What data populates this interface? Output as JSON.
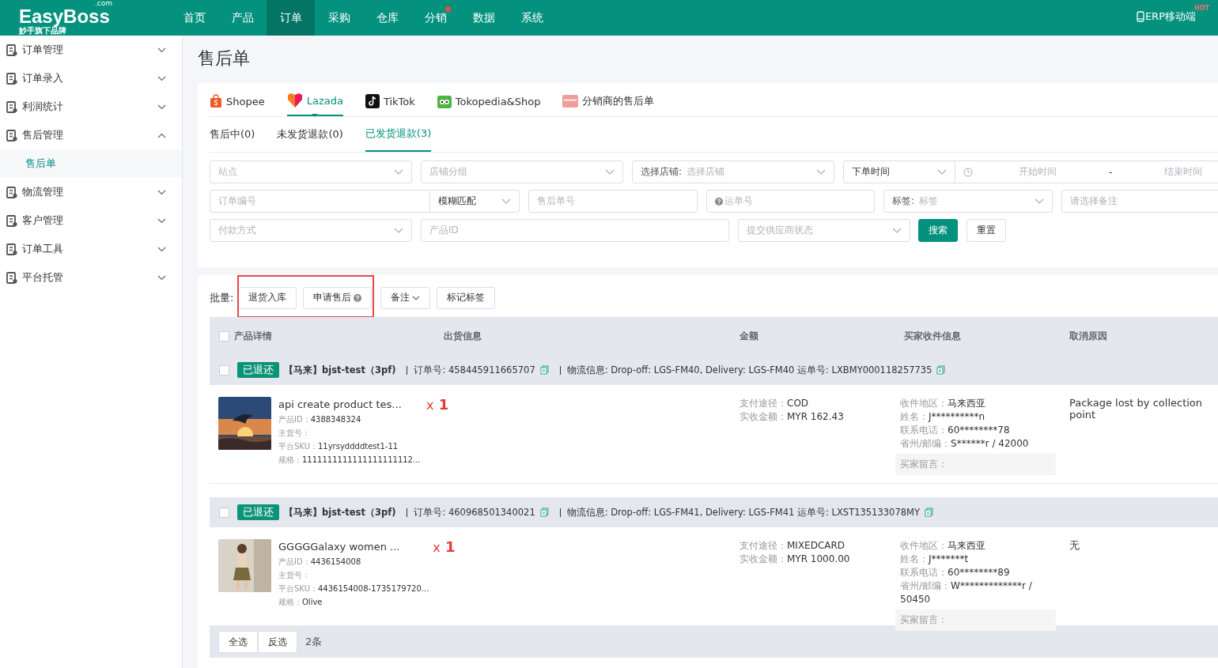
{
  "header": {
    "logo": {
      "name": "EasyBoss",
      "domain": ".com",
      "slogan": "妙手旗下品牌"
    },
    "nav": [
      {
        "label": "首页",
        "selected": false,
        "dot": false
      },
      {
        "label": "产品",
        "selected": false,
        "dot": false
      },
      {
        "label": "订单",
        "selected": true,
        "dot": false
      },
      {
        "label": "采购",
        "selected": false,
        "dot": false
      },
      {
        "label": "仓库",
        "selected": false,
        "dot": false
      },
      {
        "label": "分销",
        "selected": false,
        "dot": true
      },
      {
        "label": "数据",
        "selected": false,
        "dot": false
      },
      {
        "label": "系统",
        "selected": false,
        "dot": false
      }
    ],
    "mobile": {
      "label": "ERP移动端",
      "badge": "HOT"
    }
  },
  "sidebar": {
    "items": [
      {
        "label": "订单管理",
        "expanded": false
      },
      {
        "label": "订单录入",
        "expanded": false
      },
      {
        "label": "利润统计",
        "expanded": false
      },
      {
        "label": "售后管理",
        "expanded": true,
        "children": [
          {
            "label": "售后单",
            "selected": true
          }
        ]
      },
      {
        "label": "物流管理",
        "expanded": false
      },
      {
        "label": "客户管理",
        "expanded": false
      },
      {
        "label": "订单工具",
        "expanded": false
      },
      {
        "label": "平台托管",
        "expanded": false
      }
    ]
  },
  "page_title": "售后单",
  "platform_tabs": [
    {
      "label": "Shopee",
      "selected": false
    },
    {
      "label": "Lazada",
      "selected": true
    },
    {
      "label": "TikTok",
      "selected": false
    },
    {
      "label": "Tokopedia&Shop",
      "selected": false
    },
    {
      "label": "分销商的售后单",
      "selected": false
    }
  ],
  "status_tabs": [
    {
      "label": "售后中(0)",
      "selected": false
    },
    {
      "label": "未发货退款(0)",
      "selected": false
    },
    {
      "label": "已发货退款(3)",
      "selected": true
    }
  ],
  "filters": [
    [
      {
        "kind": "select",
        "placeholder": "站点"
      },
      {
        "kind": "select",
        "placeholder": "店铺分组"
      },
      {
        "kind": "labeled-select",
        "label": "选择店铺:",
        "placeholder": "选择店铺"
      },
      {
        "kind": "date-range",
        "label": "下单时间",
        "start": "开始时间",
        "separator": "-",
        "end": "结束时间"
      }
    ],
    [
      {
        "kind": "input-select",
        "placeholder": "订单编号",
        "value": "模糊匹配"
      },
      {
        "kind": "input",
        "placeholder": "售后单号"
      },
      {
        "kind": "help-input",
        "placeholder": "运单号"
      },
      {
        "kind": "labeled-select",
        "label": "标签:",
        "placeholder": "标签"
      },
      {
        "kind": "input",
        "placeholder": "请选择备注"
      }
    ],
    [
      {
        "kind": "select",
        "placeholder": "付款方式"
      },
      {
        "kind": "input",
        "placeholder": "产品ID"
      },
      {
        "kind": "select",
        "placeholder": "提交供应商状态"
      },
      {
        "kind": "primary",
        "label": "搜索"
      },
      {
        "kind": "plain",
        "label": "重置"
      }
    ]
  ],
  "batch": {
    "label": "批量:",
    "buttons": [
      {
        "label": "退货入库",
        "kind": "plain"
      },
      {
        "label": "申请售后",
        "kind": "help"
      },
      {
        "label": "备注",
        "kind": "dropdown"
      },
      {
        "label": "标记标签",
        "kind": "plain"
      }
    ]
  },
  "table": {
    "header_checked": false,
    "columns": [
      "产品详情",
      "出货信息",
      "金额",
      "买家收件信息",
      "取消原因"
    ],
    "orders": [
      {
        "checked": false,
        "status": "已退还",
        "shop": "【马来】bjst-test（3pf)",
        "order_no": "订单号: 458445911665707",
        "logistics": "物流信息: Drop-off: LGS-FM40, Delivery: LGS-FM40 运单号: LXBMY000118257735",
        "product": {
          "title": "api create product tes...",
          "qty_prefix": "x",
          "qty": "1",
          "lines": [
            {
              "label": "产品ID：",
              "value": "4388348324"
            },
            {
              "label": "主货号："
            },
            {
              "label": "平台SKU：",
              "value": "11yrsyddddtest1-11"
            },
            {
              "label": "规格：",
              "value": "1111111111111111111112..."
            }
          ]
        },
        "amount": [
          {
            "label": "支付途径：",
            "value": "COD"
          },
          {
            "label": "实收金额：",
            "value": "MYR 162.43"
          }
        ],
        "buyer": [
          {
            "label": "收件地区：",
            "value": "马来西亚"
          },
          {
            "label": "姓名：",
            "value": "J**********n"
          },
          {
            "label": "联系电话：",
            "value": "60********78"
          },
          {
            "label": "省州/邮编：",
            "value": "S******r / 42000"
          }
        ],
        "note": "买家留言：",
        "reason": "Package lost by collection point"
      },
      {
        "checked": false,
        "status": "已退还",
        "shop": "【马来】bjst-test（3pf)",
        "order_no": "订单号: 460968501340021",
        "logistics": "物流信息: Drop-off: LGS-FM41, Delivery: LGS-FM41 运单号: LXST135133078MY",
        "product": {
          "title": "GGGGGalaxy women ...",
          "qty_prefix": "x",
          "qty": "1",
          "lines": [
            {
              "label": "产品ID：",
              "value": "4436154008"
            },
            {
              "label": "主货号："
            },
            {
              "label": "平台SKU：",
              "value": "4436154008-1735179720..."
            },
            {
              "label": "规格：",
              "value": "Olive"
            }
          ]
        },
        "amount": [
          {
            "label": "支付途径：",
            "value": "MIXEDCARD"
          },
          {
            "label": "实收金额：",
            "value": "MYR 1000.00"
          }
        ],
        "buyer": [
          {
            "label": "收件地区：",
            "value": "马来西亚"
          },
          {
            "label": "姓名：",
            "value": "J*******t"
          },
          {
            "label": "联系电话：",
            "value": "60********89"
          },
          {
            "label": "省州/邮编：",
            "value": "W*************r / 50450"
          }
        ],
        "note": "买家留言：",
        "reason": "无"
      }
    ]
  },
  "footer": {
    "buttons": [
      "全选",
      "反选"
    ],
    "count": "2条"
  }
}
